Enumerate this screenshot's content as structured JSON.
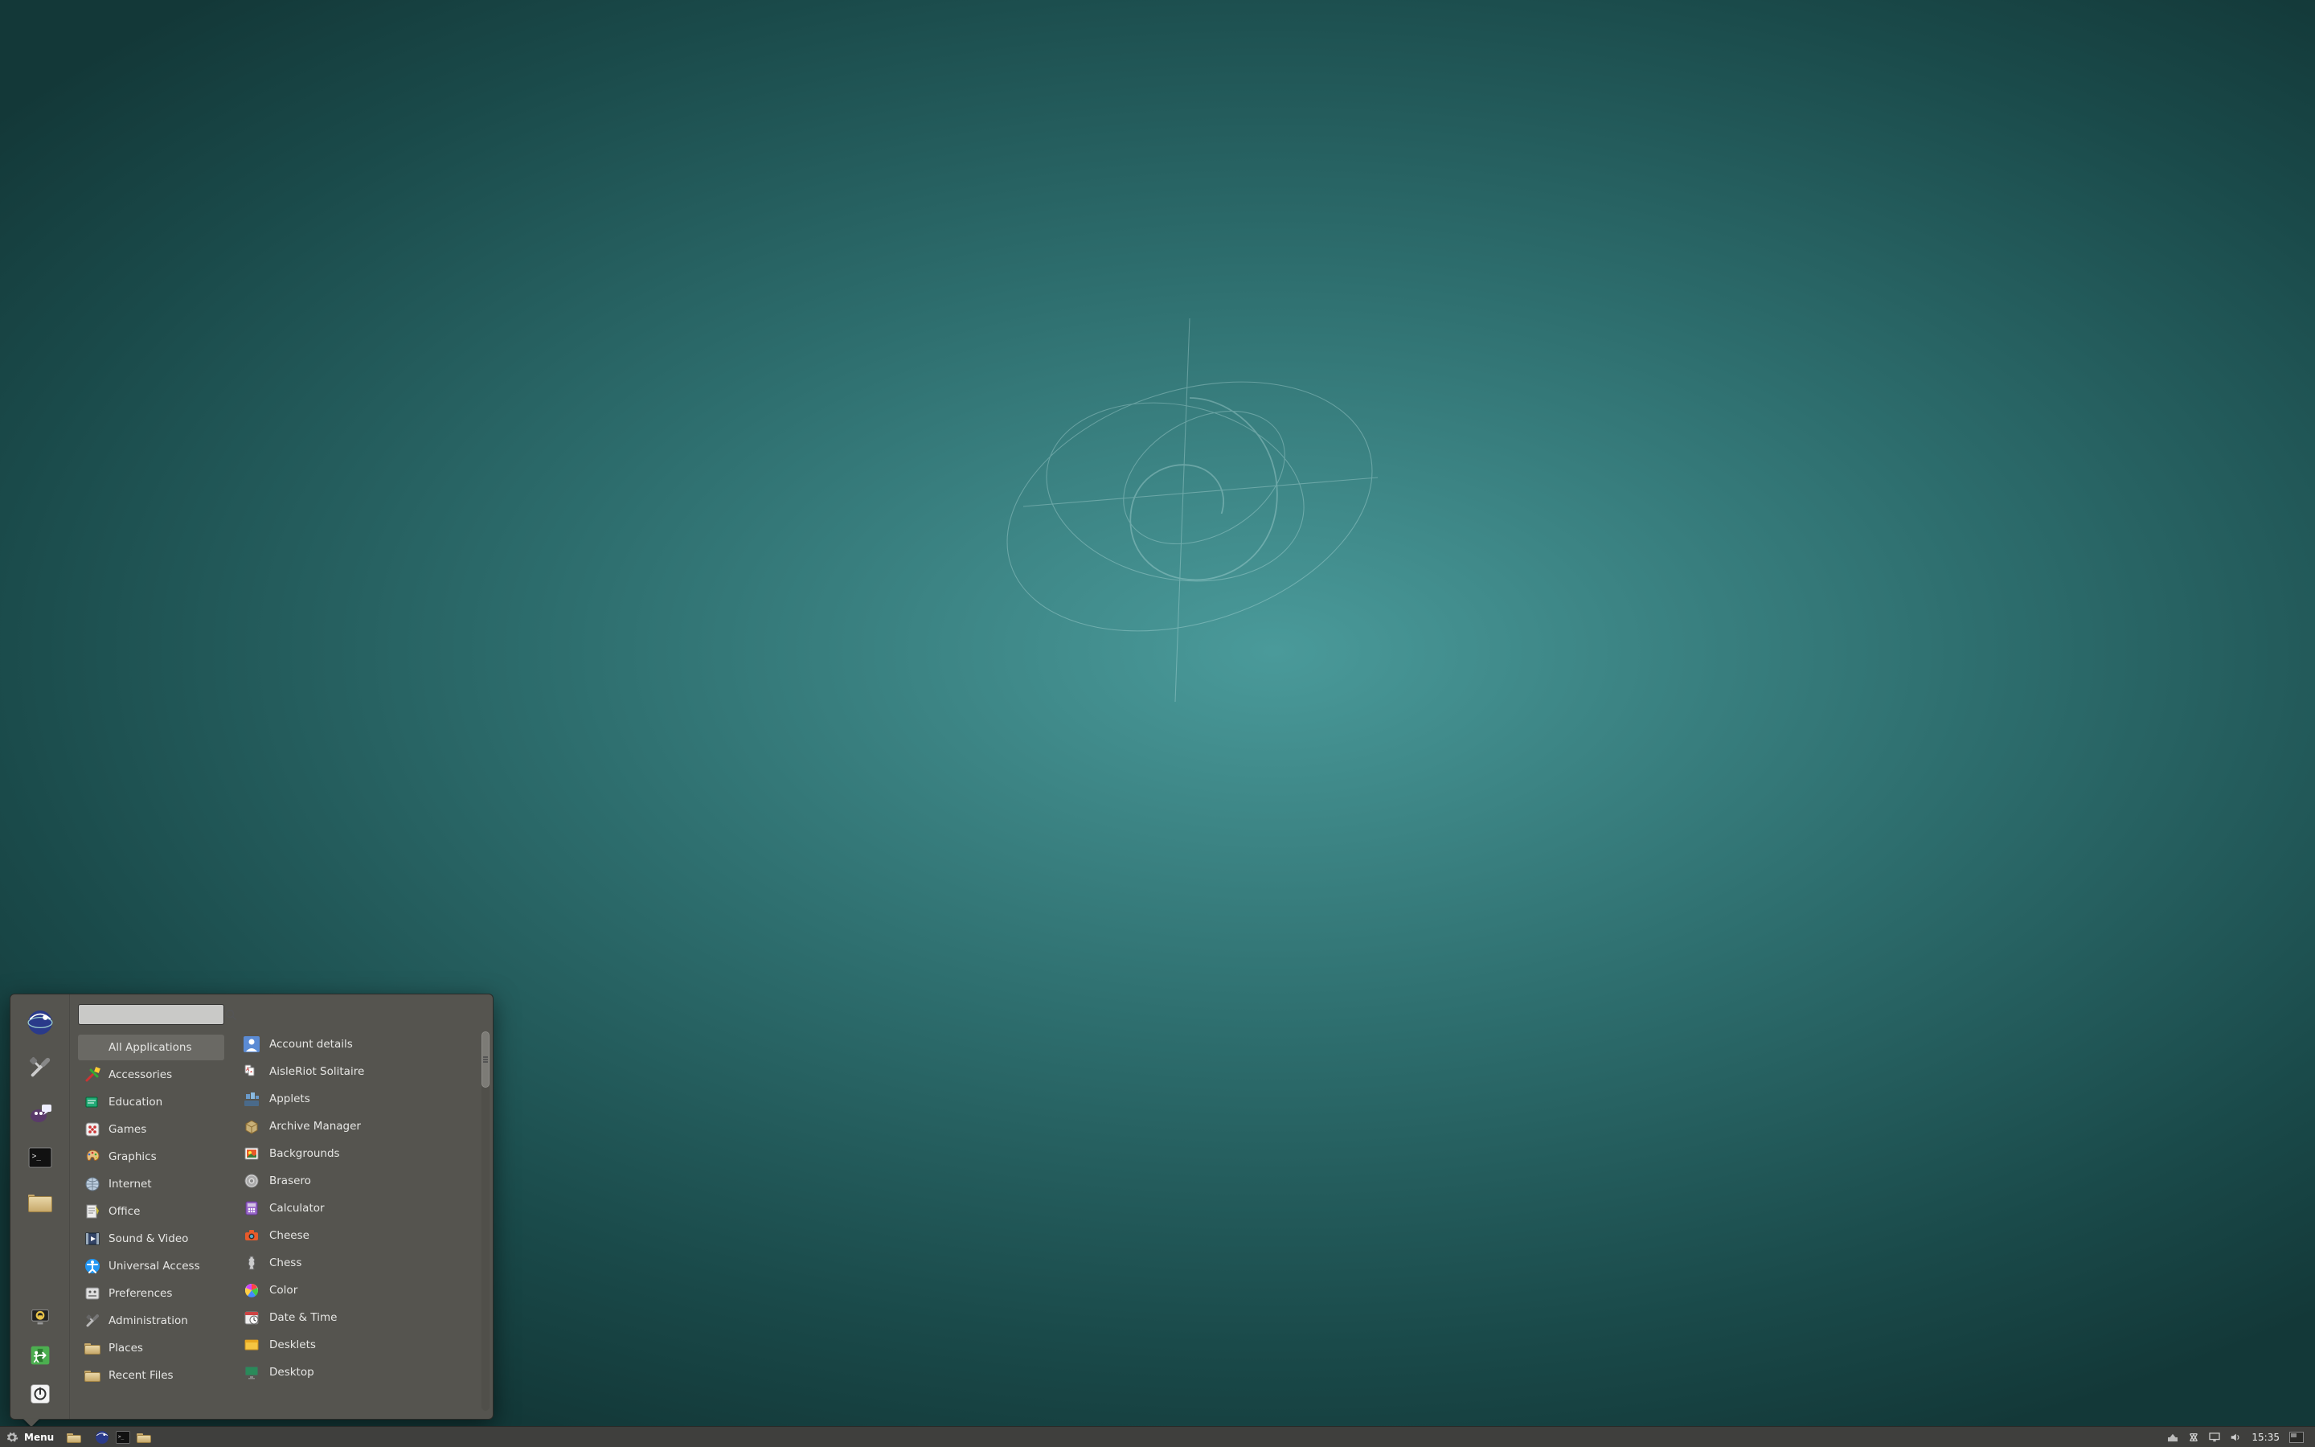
{
  "taskbar": {
    "menu_label": "Menu",
    "clock": "15:35"
  },
  "menu": {
    "search_placeholder": "",
    "categories": [
      {
        "label": "All Applications",
        "icon": "all-apps",
        "selected": true
      },
      {
        "label": "Accessories",
        "icon": "accessories"
      },
      {
        "label": "Education",
        "icon": "education"
      },
      {
        "label": "Games",
        "icon": "games"
      },
      {
        "label": "Graphics",
        "icon": "graphics"
      },
      {
        "label": "Internet",
        "icon": "internet"
      },
      {
        "label": "Office",
        "icon": "office"
      },
      {
        "label": "Sound & Video",
        "icon": "sound-video"
      },
      {
        "label": "Universal Access",
        "icon": "universal-access"
      },
      {
        "label": "Preferences",
        "icon": "preferences"
      },
      {
        "label": "Administration",
        "icon": "administration"
      },
      {
        "label": "Places",
        "icon": "places"
      },
      {
        "label": "Recent Files",
        "icon": "recent-files"
      }
    ],
    "apps": [
      {
        "label": "Account details",
        "icon": "account-details"
      },
      {
        "label": "AisleRiot Solitaire",
        "icon": "solitaire"
      },
      {
        "label": "Applets",
        "icon": "applets"
      },
      {
        "label": "Archive Manager",
        "icon": "archive-manager"
      },
      {
        "label": "Backgrounds",
        "icon": "backgrounds"
      },
      {
        "label": "Brasero",
        "icon": "brasero"
      },
      {
        "label": "Calculator",
        "icon": "calculator"
      },
      {
        "label": "Cheese",
        "icon": "cheese"
      },
      {
        "label": "Chess",
        "icon": "chess"
      },
      {
        "label": "Color",
        "icon": "color"
      },
      {
        "label": "Date & Time",
        "icon": "date-time"
      },
      {
        "label": "Desklets",
        "icon": "desklets"
      },
      {
        "label": "Desktop",
        "icon": "desktop"
      }
    ],
    "favorites": [
      {
        "name": "web-browser"
      },
      {
        "name": "system-settings"
      },
      {
        "name": "messenger"
      },
      {
        "name": "terminal"
      },
      {
        "name": "file-manager"
      }
    ],
    "session": [
      {
        "name": "lock-screen"
      },
      {
        "name": "logout"
      },
      {
        "name": "shutdown"
      }
    ]
  }
}
